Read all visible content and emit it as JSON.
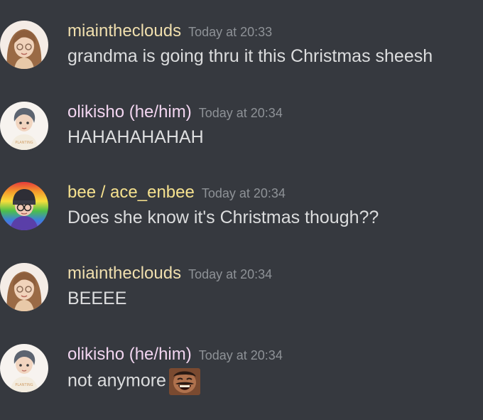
{
  "messages": [
    {
      "username": "miaintheclouds",
      "timestamp": "Today at 20:33",
      "content": "grandma is going thru it this Christmas sheesh",
      "avatar": "long-hair-girl-avatar"
    },
    {
      "username": "olikisho (he/him)",
      "timestamp": "Today at 20:34",
      "content": "HAHAHAHAHAH",
      "avatar": "gray-hair-boy-avatar",
      "avatar_shirt_text": "PLANTING"
    },
    {
      "username": "bee / ace_enbee",
      "timestamp": "Today at 20:34",
      "content": "Does she know it's Christmas though??",
      "avatar": "rainbow-beanie-avatar"
    },
    {
      "username": "miaintheclouds",
      "timestamp": "Today at 20:34",
      "content": "BEEEE",
      "avatar": "long-hair-girl-avatar"
    },
    {
      "username": "olikisho (he/him)",
      "timestamp": "Today at 20:34",
      "content": "not anymore",
      "avatar": "gray-hair-boy-avatar",
      "avatar_shirt_text": "PLANTING",
      "emoji": "laughing-man-emoji"
    }
  ],
  "colors": {
    "background": "#36393f",
    "timestamp": "#8e9297",
    "message_text": "#dcddde",
    "username_mia": "#f0dfae",
    "username_olikisho": "#f2d5f0",
    "username_bee": "#f5e18e"
  }
}
